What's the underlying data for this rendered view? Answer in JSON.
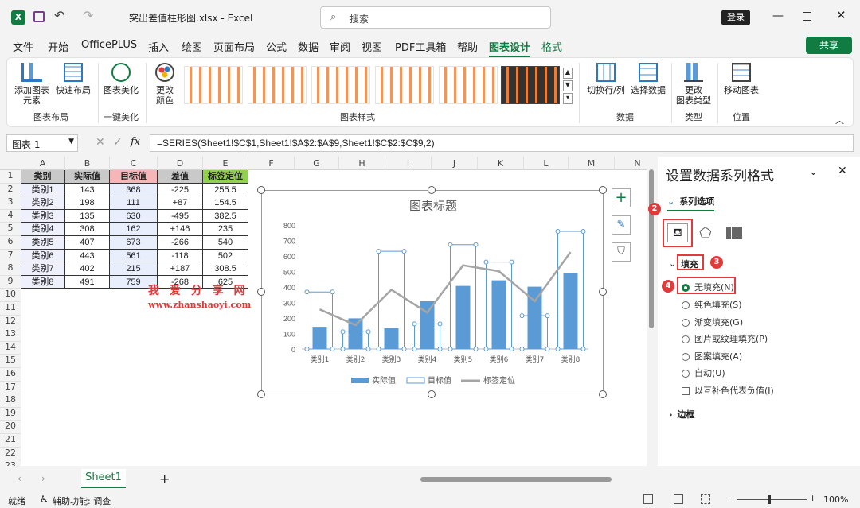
{
  "titlebar": {
    "filename": "突出差值柱形图.xlsx  -  Excel",
    "search_placeholder": "搜索",
    "login": "登录"
  },
  "tabs": [
    "文件",
    "开始",
    "OfficePLUS",
    "插入",
    "绘图",
    "页面布局",
    "公式",
    "数据",
    "审阅",
    "视图",
    "PDF工具箱",
    "帮助",
    "图表设计",
    "格式"
  ],
  "active_tab": "图表设计",
  "share": "共享",
  "ribbon": {
    "add_element": "添加图表\n元素",
    "quick_layout": "快速布局",
    "beautify": "图表美化",
    "change_color": "更改\n颜色",
    "switch_rowcol": "切换行/列",
    "select_data": "选择数据",
    "change_type": "更改\n图表类型",
    "move_chart": "移动图表",
    "groups": {
      "layout": "图表布局",
      "beauty": "一键美化",
      "styles": "图表样式",
      "data": "数据",
      "type": "类型",
      "position": "位置"
    }
  },
  "formula_bar": {
    "name_box": "图表 1",
    "fx": "fx",
    "formula": "=SERIES(Sheet1!$C$1,Sheet1!$A$2:$A$9,Sheet1!$C$2:$C$9,2)"
  },
  "columns": [
    "A",
    "B",
    "C",
    "D",
    "E",
    "F",
    "G",
    "H",
    "I",
    "J",
    "K",
    "L",
    "M",
    "N"
  ],
  "rows": [
    "1",
    "2",
    "3",
    "4",
    "5",
    "6",
    "7",
    "8",
    "9",
    "10",
    "11",
    "12",
    "13",
    "14",
    "15",
    "16",
    "17",
    "18",
    "19",
    "20",
    "21",
    "22",
    "23"
  ],
  "table": {
    "headers": [
      "类别",
      "实际值",
      "目标值",
      "差值",
      "标签定位"
    ],
    "data": [
      [
        "类别1",
        "143",
        "368",
        "-225",
        "255.5"
      ],
      [
        "类别2",
        "198",
        "111",
        "+87",
        "154.5"
      ],
      [
        "类别3",
        "135",
        "630",
        "-495",
        "382.5"
      ],
      [
        "类别4",
        "308",
        "162",
        "+146",
        "235"
      ],
      [
        "类别5",
        "407",
        "673",
        "-266",
        "540"
      ],
      [
        "类别6",
        "443",
        "561",
        "-118",
        "502"
      ],
      [
        "类别7",
        "402",
        "215",
        "+187",
        "308.5"
      ],
      [
        "类别8",
        "491",
        "759",
        "-268",
        "625"
      ]
    ]
  },
  "watermark": {
    "line1": "我 爱 分 享 网",
    "line2": "www.zhanshaoyi.com"
  },
  "chart_data": {
    "type": "bar",
    "title": "图表标题",
    "categories": [
      "类别1",
      "类别2",
      "类别3",
      "类别4",
      "类别5",
      "类别6",
      "类别7",
      "类别8"
    ],
    "series": [
      {
        "name": "实际值",
        "values": [
          143,
          198,
          135,
          308,
          407,
          443,
          402,
          491
        ],
        "color": "#5b9bd5"
      },
      {
        "name": "目标值",
        "values": [
          368,
          111,
          630,
          162,
          673,
          561,
          215,
          759
        ],
        "color": "#5b9bd5"
      },
      {
        "name": "标签定位",
        "values": [
          255.5,
          154.5,
          382.5,
          235,
          540,
          502,
          308.5,
          625
        ],
        "color": "#a5a5a5"
      }
    ],
    "ylim": [
      0,
      800
    ],
    "yticks": [
      "0",
      "100",
      "200",
      "300",
      "400",
      "500",
      "600",
      "700",
      "800"
    ],
    "legend": "bottom",
    "grid": false
  },
  "panel": {
    "title": "设置数据系列格式",
    "series_options": "系列选项",
    "fill": "填充",
    "options": [
      "无填充(N)",
      "纯色填充(S)",
      "渐变填充(G)",
      "图片或纹理填充(P)",
      "图案填充(A)",
      "自动(U)"
    ],
    "invert": "以互补色代表负值(I)",
    "border": "边框",
    "badges": [
      "2",
      "3",
      "4"
    ]
  },
  "sheet_tab": "Sheet1",
  "status": {
    "ready": "就绪",
    "accessibility": "辅助功能: 调查",
    "zoom": "100%"
  }
}
